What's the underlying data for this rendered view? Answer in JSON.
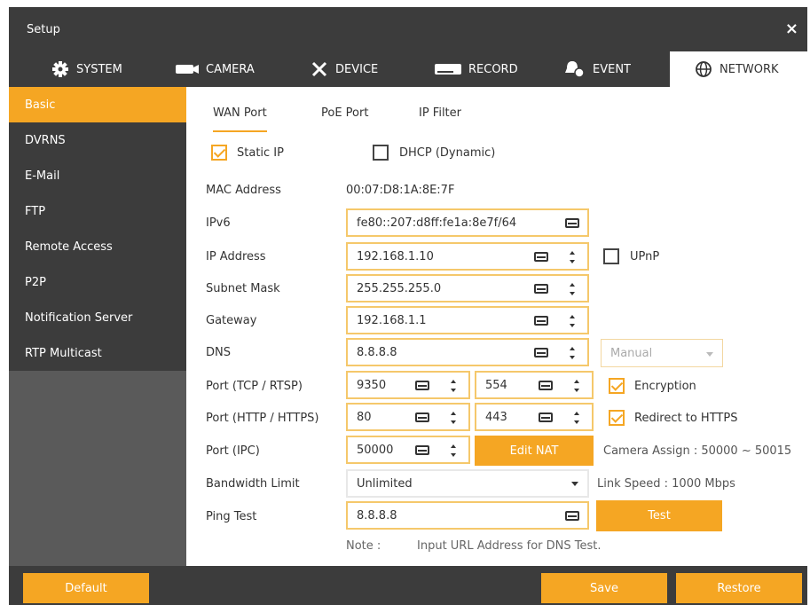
{
  "window": {
    "title": "Setup",
    "close": "×"
  },
  "tabs": [
    {
      "label": "SYSTEM",
      "icon": "gear-icon"
    },
    {
      "label": "CAMERA",
      "icon": "camera-icon"
    },
    {
      "label": "DEVICE",
      "icon": "tools-icon"
    },
    {
      "label": "RECORD",
      "icon": "record-icon"
    },
    {
      "label": "EVENT",
      "icon": "event-icon"
    },
    {
      "label": "NETWORK",
      "icon": "globe-icon",
      "active": true
    }
  ],
  "sidebar": {
    "items": [
      {
        "label": "Basic",
        "active": true
      },
      {
        "label": "DVRNS"
      },
      {
        "label": "E-Mail"
      },
      {
        "label": "FTP"
      },
      {
        "label": "Remote Access"
      },
      {
        "label": "P2P"
      },
      {
        "label": "Notification Server"
      },
      {
        "label": "RTP Multicast"
      }
    ]
  },
  "subtabs": [
    "WAN Port",
    "PoE Port",
    "IP Filter"
  ],
  "form": {
    "static_ip": "Static IP",
    "dhcp": "DHCP (Dynamic)",
    "mac_label": "MAC Address",
    "mac_value": "00:07:D8:1A:8E:7F",
    "ipv6_label": "IPv6",
    "ipv6_value": "fe80::207:d8ff:fe1a:8e7f/64",
    "ip_label": "IP Address",
    "ip_value": "192.168.1.10",
    "upnp": "UPnP",
    "subnet_label": "Subnet Mask",
    "subnet_value": "255.255.255.0",
    "gateway_label": "Gateway",
    "gateway_value": "192.168.1.1",
    "dns_label": "DNS",
    "dns_value": "8.8.8.8",
    "dns_mode": "Manual",
    "port_tcp_label": "Port (TCP / RTSP)",
    "port_tcp_value": "9350",
    "port_rtsp_value": "554",
    "encryption": "Encryption",
    "port_http_label": "Port (HTTP / HTTPS)",
    "port_http_value": "80",
    "port_https_value": "443",
    "redirect": "Redirect to HTTPS",
    "port_ipc_label": "Port (IPC)",
    "port_ipc_value": "50000",
    "edit_nat": "Edit NAT",
    "camera_assign": "Camera Assign : 50000 ~ 50015",
    "bandwidth_label": "Bandwidth Limit",
    "bandwidth_value": "Unlimited",
    "link_speed": "Link Speed : 1000 Mbps",
    "ping_label": "Ping Test",
    "ping_value": "8.8.8.8",
    "test": "Test",
    "note_label": "Note :",
    "note_text": "Input URL Address for DNS Test."
  },
  "footer": {
    "default": "Default",
    "save": "Save",
    "restore": "Restore"
  },
  "colors": {
    "accent": "#f5a623",
    "dark": "#3c3c3c"
  }
}
